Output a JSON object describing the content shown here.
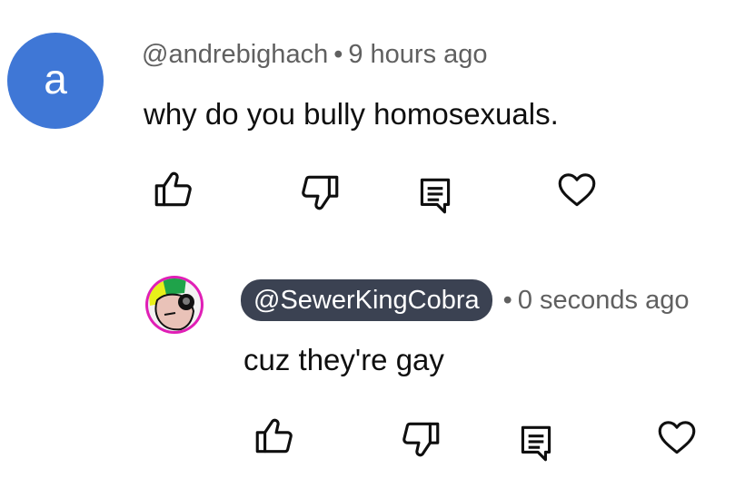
{
  "comments": [
    {
      "avatar_letter": "a",
      "author": "@andrebighach",
      "separator": "•",
      "time": "9 hours ago",
      "text": "why do you bully homosexuals."
    }
  ],
  "reply": {
    "author": "@SewerKingCobra",
    "separator": "•",
    "time": "0 seconds ago",
    "text": "cuz they're gay"
  },
  "actions": {
    "like_icon": "thumbs-up-icon",
    "dislike_icon": "thumbs-down-icon",
    "reply_icon": "comment-icon",
    "heart_icon": "heart-icon"
  },
  "colors": {
    "avatar_bg": "#3f77d6",
    "chip_bg": "#3b4252",
    "meta_text": "#606060"
  }
}
